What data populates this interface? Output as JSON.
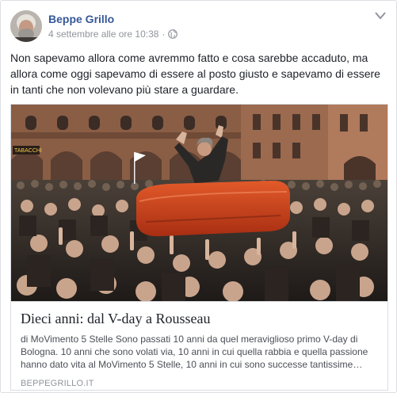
{
  "author": {
    "name": "Beppe Grillo",
    "timestamp": "4 settembre alle ore 10:38",
    "separator": "·",
    "privacy_icon": "globe-icon"
  },
  "post": {
    "text": "Non sapevamo allora come avremmo fatto e cosa sarebbe accaduto, ma allora come oggi sapevamo di essere al posto giusto e sapevamo di essere in tanti che non volevano più stare a guardare."
  },
  "link_card": {
    "title": "Dieci anni: dal V-day a Rousseau",
    "description": "di MoVimento 5 Stelle Sono passati 10 anni da quel meraviglioso primo V-day di Bologna. 10 anni che sono volati via, 10 anni in cui quella rabbia e quella passione hanno dato vita al MoVimento 5 Stelle, 10 anni in cui sono successe tantissime…",
    "domain": "BEPPEGRILLO.IT",
    "photo_signage": "TABACCHI"
  },
  "icons": {
    "options": "chevron-down-icon",
    "privacy": "globe-icon"
  },
  "colors": {
    "author_name": "#365899",
    "meta_text": "#90949c",
    "boat": "#d9431e"
  }
}
